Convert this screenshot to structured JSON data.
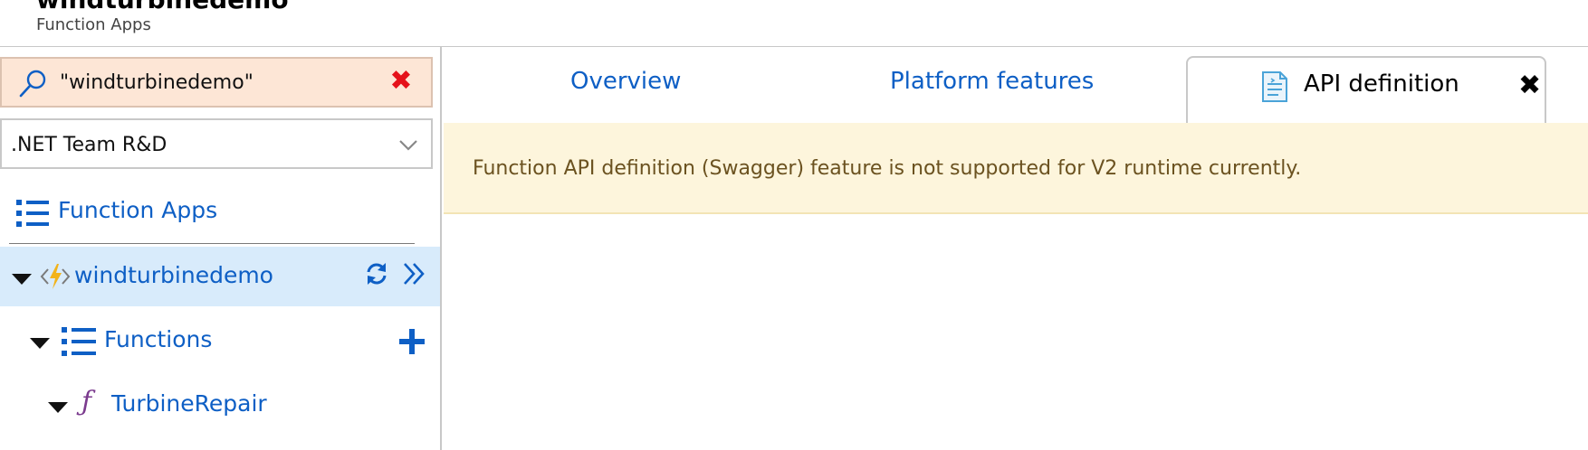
{
  "header": {
    "title": "windturbinedemo",
    "subtitle": "Function Apps"
  },
  "sidebar": {
    "search": {
      "value": "\"windturbinedemo\"",
      "icon": "search-icon",
      "clear_icon": "close-icon"
    },
    "subscription": {
      "selected": ".NET Team R&D",
      "icon": "chevron-down-icon"
    },
    "function_apps_label": "Function Apps",
    "tree": {
      "app": {
        "label": "windturbinedemo",
        "refresh_icon": "refresh-icon",
        "expand_icon": "double-chevron-right-icon"
      },
      "functions": {
        "label": "Functions",
        "add_icon": "plus-icon"
      },
      "function": {
        "label": "TurbineRepair",
        "icon": "function-icon"
      }
    }
  },
  "main": {
    "tabs": [
      {
        "label": "Overview"
      },
      {
        "label": "Platform features"
      },
      {
        "label": "API definition",
        "icon": "api-document-icon",
        "close_icon": "close-icon"
      }
    ],
    "warning": "Function API definition (Swagger) feature is not supported for V2 runtime currently."
  },
  "colors": {
    "accent": "#0e5fc5",
    "search_bg": "#fde6d6",
    "selected_row_bg": "#d8ebfb",
    "warning_bg": "#fdf5dc",
    "warning_text": "#6b5220",
    "clear_red": "#e5121b",
    "lightning": "#f2b31a"
  }
}
